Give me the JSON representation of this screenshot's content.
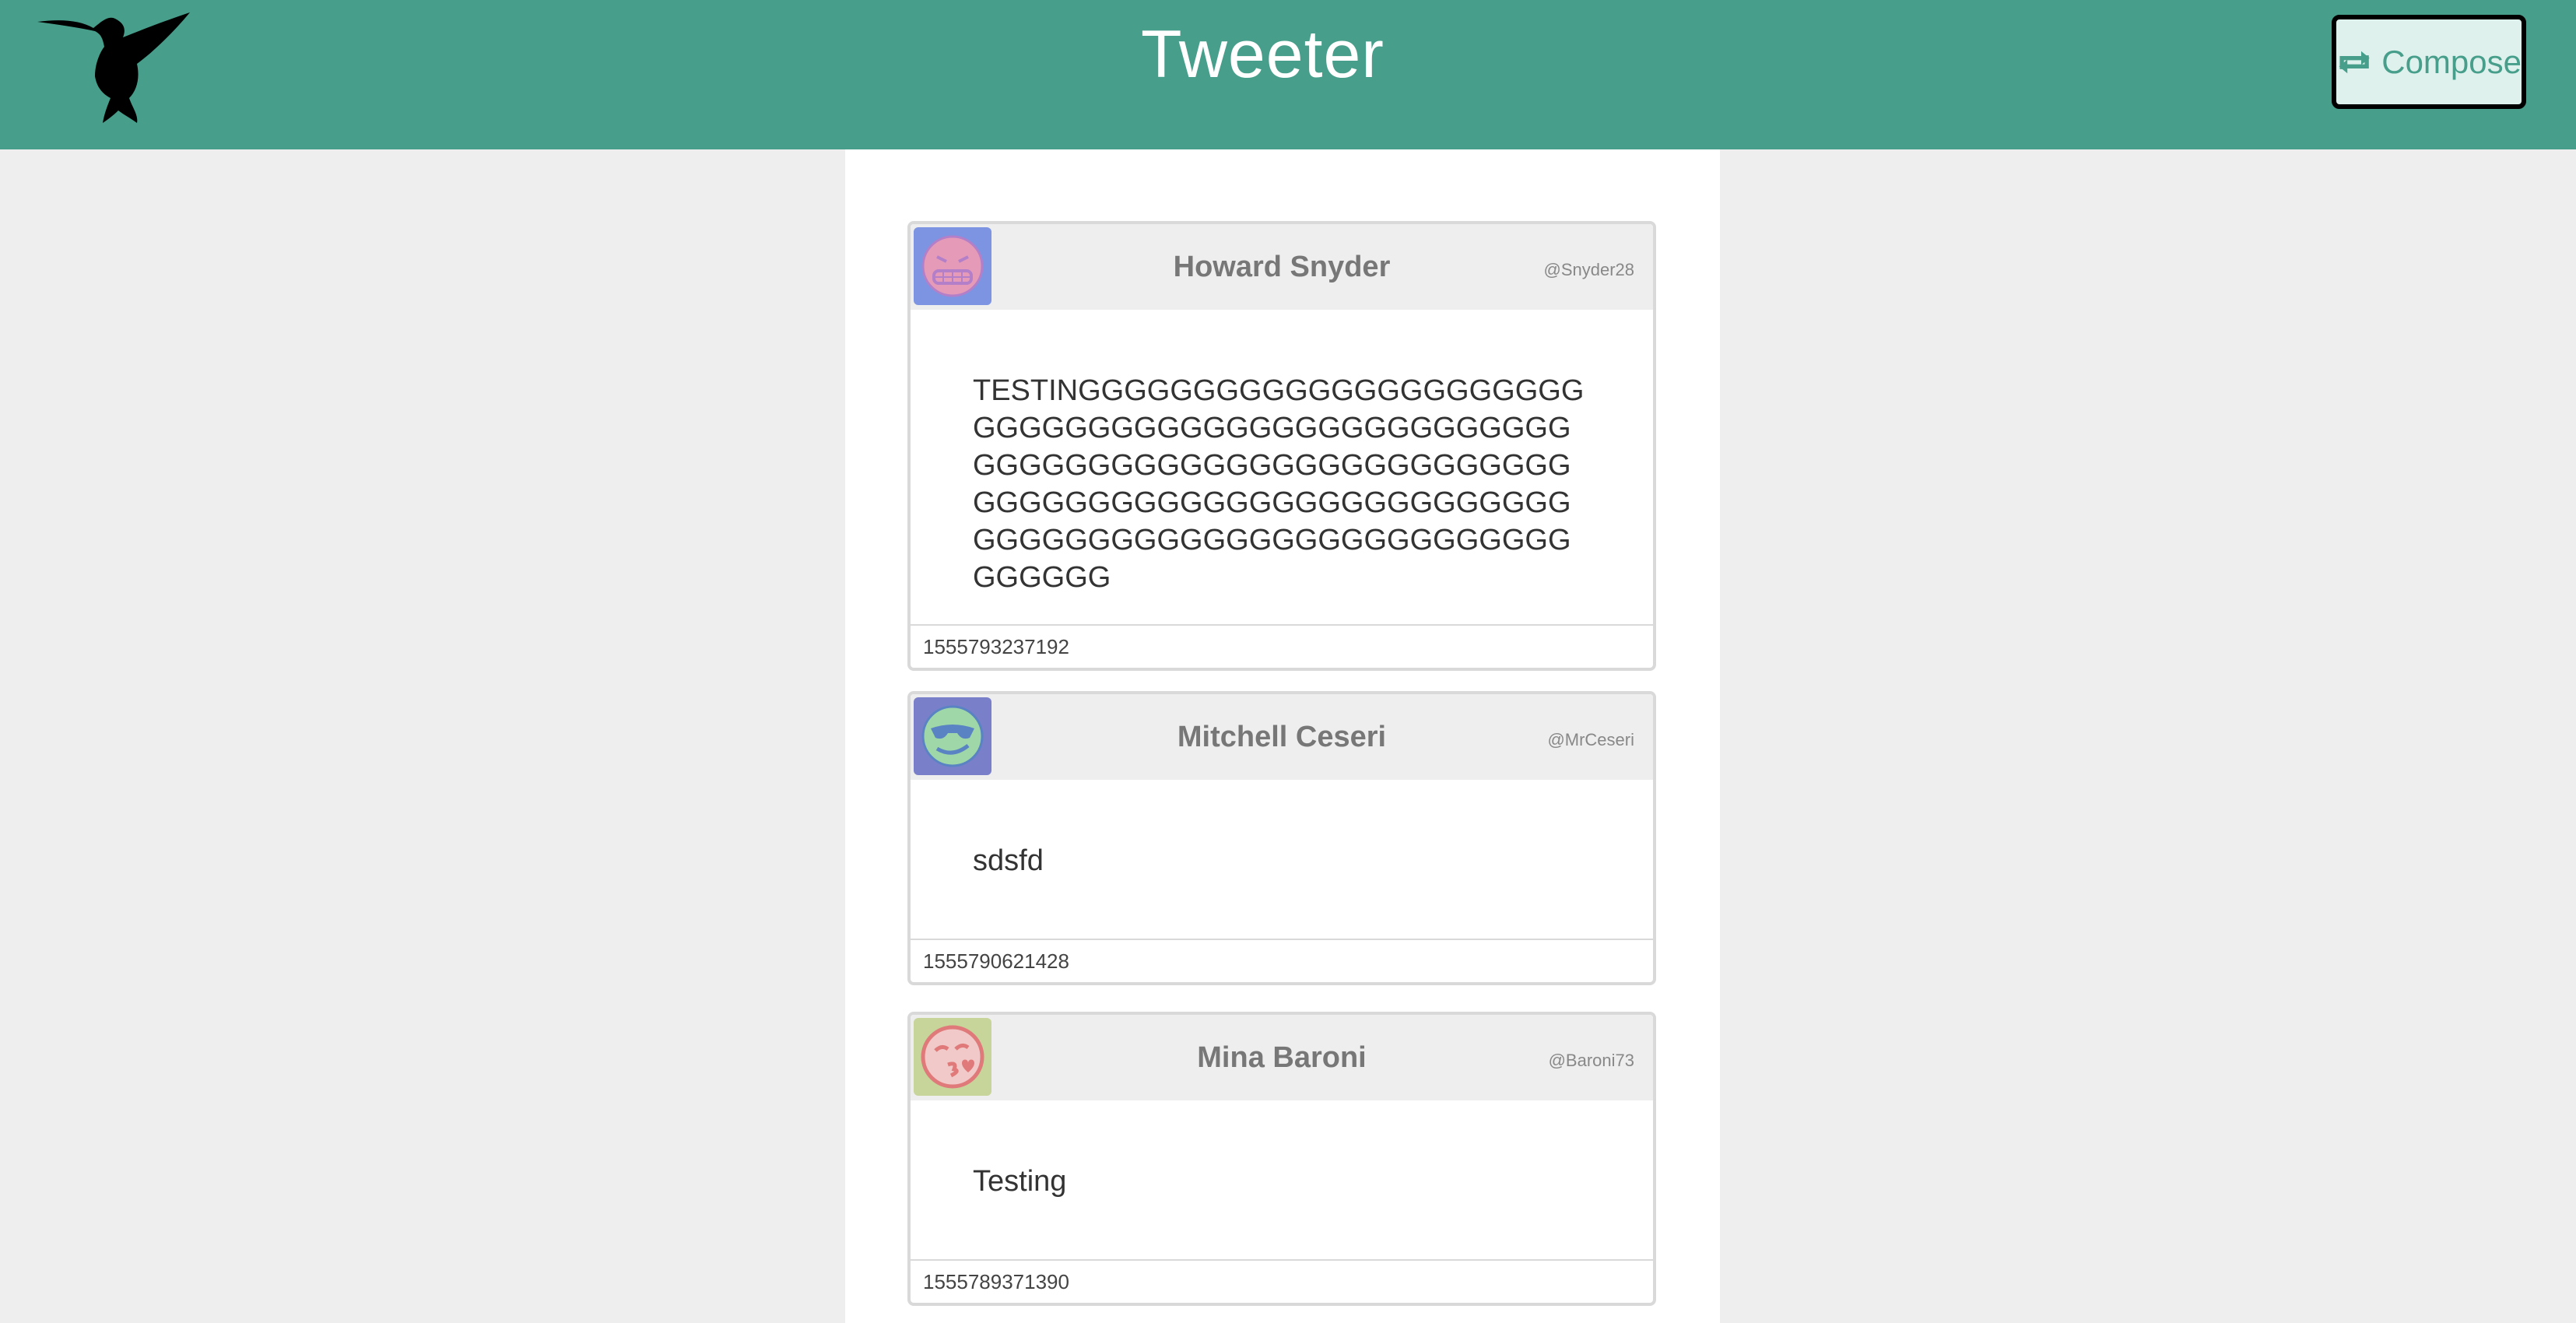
{
  "header": {
    "brand": "Tweeter",
    "logo_icon": "hummingbird-icon",
    "compose_label": "Compose",
    "compose_icon": "retweet-icon"
  },
  "tweets": [
    {
      "name": "Howard Snyder",
      "handle": "@Snyder28",
      "text": "TESTINGGGGGGGGGGGGGGGGGGGGGGGGGGGGGGGGGGGGGGGGGGGGGGGGGGGGGGGGGGGGGGGGGGGGGGGGGGGGGGGGGGGGGGGGGGGGGGGGGGGGGGGGGGGGGGGGGGGGGGGGGGGGGGGGGGGG",
      "timestamp": "1555793237192",
      "avatar": "grimace-face-avatar"
    },
    {
      "name": "Mitchell Ceseri",
      "handle": "@MrCeseri",
      "text": "sdsfd",
      "timestamp": "1555790621428",
      "avatar": "sunglasses-face-avatar"
    },
    {
      "name": "Mina Baroni",
      "handle": "@Baroni73",
      "text": "Testing",
      "timestamp": "1555789371390",
      "avatar": "kiss-face-avatar"
    }
  ],
  "colors": {
    "navbar": "#479f8b",
    "page_background": "#eeeeee",
    "compose_background": "#dff1ed"
  }
}
